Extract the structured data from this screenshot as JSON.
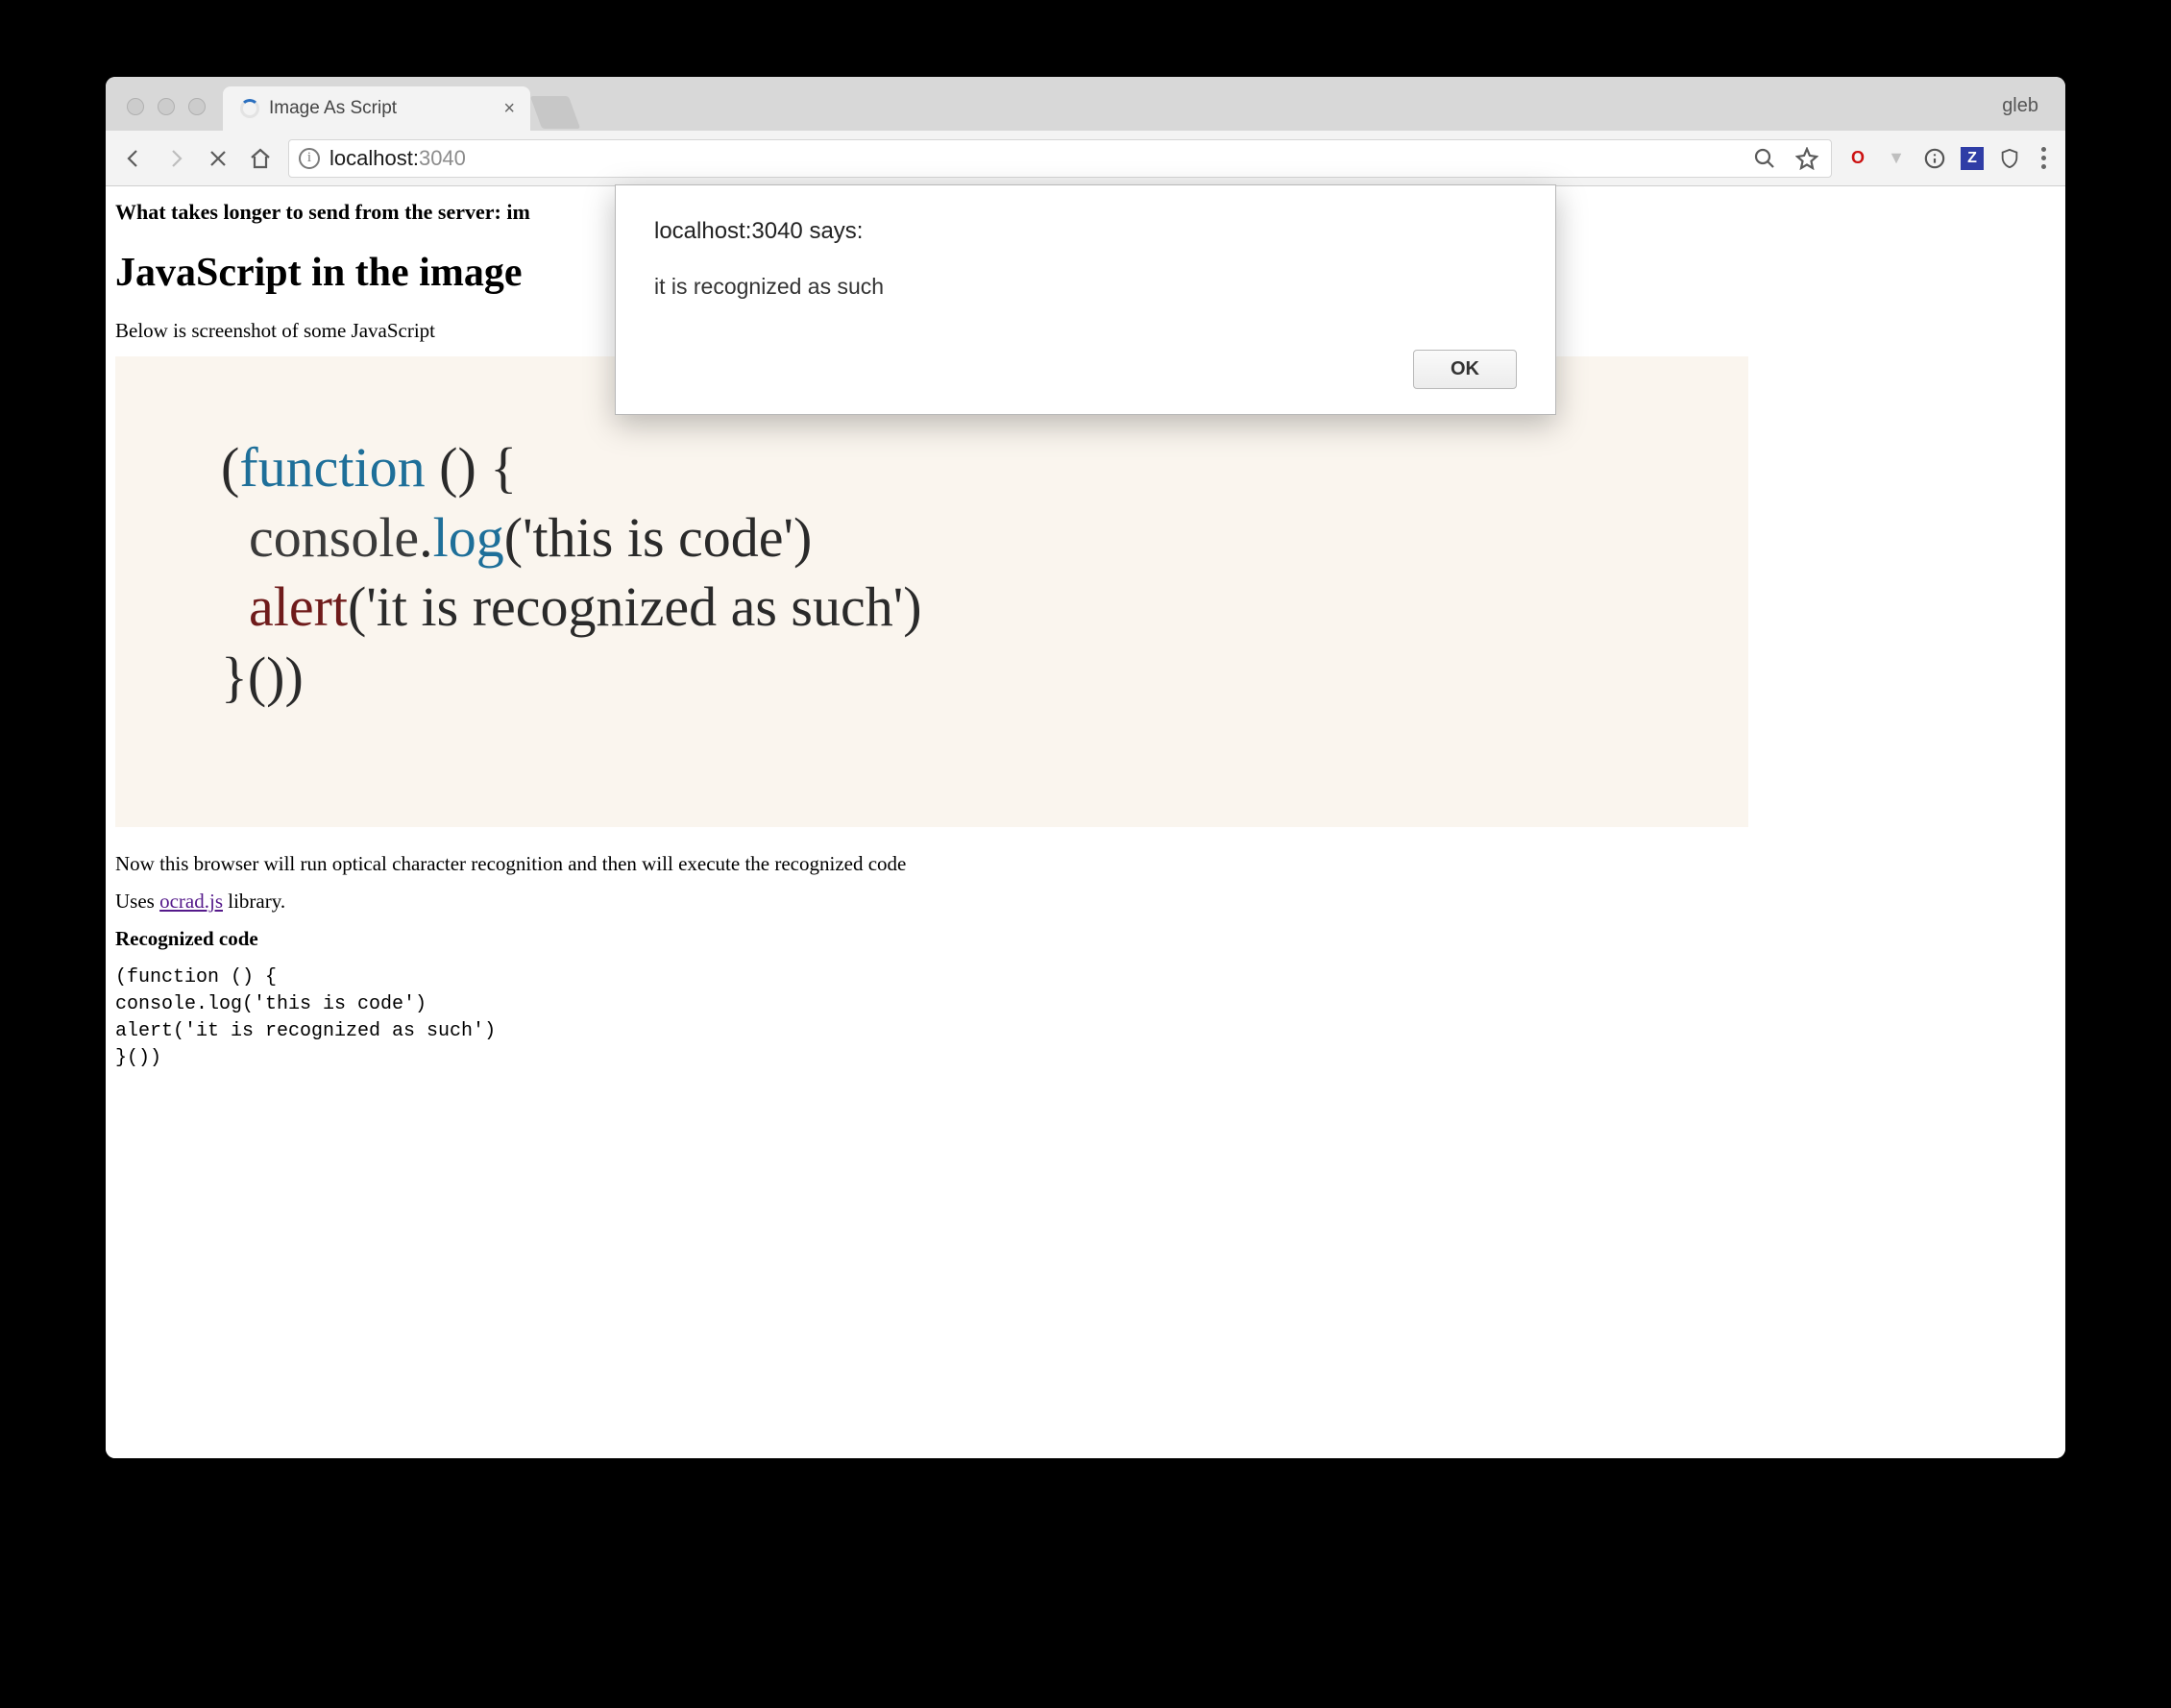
{
  "chrome": {
    "tab_title": "Image As Script",
    "profile": "gleb",
    "url_host": "localhost:",
    "url_port": "3040"
  },
  "alert": {
    "header": "localhost:3040 says:",
    "message": "it is recognized as such",
    "ok": "OK"
  },
  "page": {
    "intro_bold": "What takes longer to send from the server: im",
    "h2": "JavaScript in the image",
    "p_below": "Below is screenshot of some JavaScript",
    "p_now": "Now this browser will run optical character recognition and then will execute the recognized code",
    "uses_pre": "Uses ",
    "uses_link": "ocrad.js",
    "uses_post": " library.",
    "rec_hdr": "Recognized code",
    "rec_code": "(function () {\nconsole.log('this is code')\nalert('it is recognized as such')\n}())",
    "codeimg": {
      "l1a": "(",
      "l1b": "function",
      "l1c": " () {",
      "l2a": "  console",
      "l2b": ".",
      "l2c": "log",
      "l2d": "('this is code')",
      "l3a": "  ",
      "l3b": "alert",
      "l3c": "('it is recognized as such')",
      "l4": "}())"
    }
  }
}
